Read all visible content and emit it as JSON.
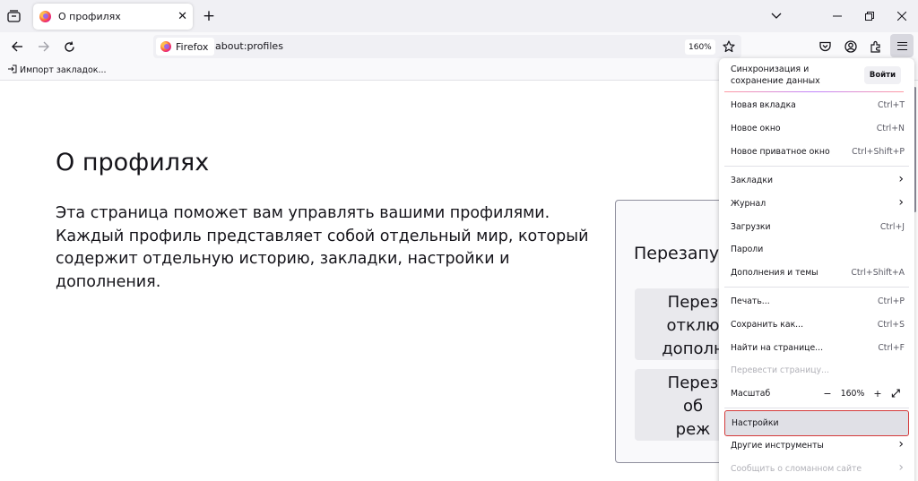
{
  "tab": {
    "title": "О профилях",
    "close": "✕",
    "new": "+"
  },
  "navbar": {
    "identity_label": "Firefox",
    "url": "about:profiles",
    "zoom_badge": "160%"
  },
  "bookmarks": {
    "import_label": "Импорт закладок..."
  },
  "page": {
    "title": "О профилях",
    "description_lines": [
      "Эта страница поможет вам управлять вашими профилями.",
      "Каждый профиль представляет собой отдельный мир, который",
      "содержит отдельную историю, закладки, настройки и дополнения."
    ],
    "card": {
      "heading": "Перезапу",
      "button1_lines": [
        "Перез",
        "отклю",
        "дополн"
      ],
      "button2_lines": [
        "Перез",
        "об",
        "реж"
      ]
    }
  },
  "menu": {
    "sync_line1": "Синхронизация и",
    "sync_line2": "сохранение данных",
    "login": "Войти",
    "items": [
      {
        "label": "Новая вкладка",
        "shortcut": "Ctrl+T"
      },
      {
        "label": "Новое окно",
        "shortcut": "Ctrl+N"
      },
      {
        "label": "Новое приватное окно",
        "shortcut": "Ctrl+Shift+P"
      },
      {
        "label": "Закладки",
        "shortcut": ""
      },
      {
        "label": "Журнал",
        "shortcut": ""
      },
      {
        "label": "Загрузки",
        "shortcut": "Ctrl+J"
      },
      {
        "label": "Пароли",
        "shortcut": ""
      },
      {
        "label": "Дополнения и темы",
        "shortcut": "Ctrl+Shift+A"
      },
      {
        "label": "Печать...",
        "shortcut": "Ctrl+P"
      },
      {
        "label": "Сохранить как...",
        "shortcut": "Ctrl+S"
      },
      {
        "label": "Найти на странице...",
        "shortcut": "Ctrl+F"
      },
      {
        "label": "Перевести страницу...",
        "shortcut": ""
      },
      {
        "label": "Масштаб",
        "shortcut": ""
      },
      {
        "label": "Настройки",
        "shortcut": ""
      },
      {
        "label": "Другие инструменты",
        "shortcut": ""
      },
      {
        "label": "Сообщить о сломанном сайте",
        "shortcut": ""
      }
    ],
    "zoom": {
      "minus": "−",
      "value": "160%",
      "plus": "+",
      "fullscreen": "⤢"
    }
  }
}
